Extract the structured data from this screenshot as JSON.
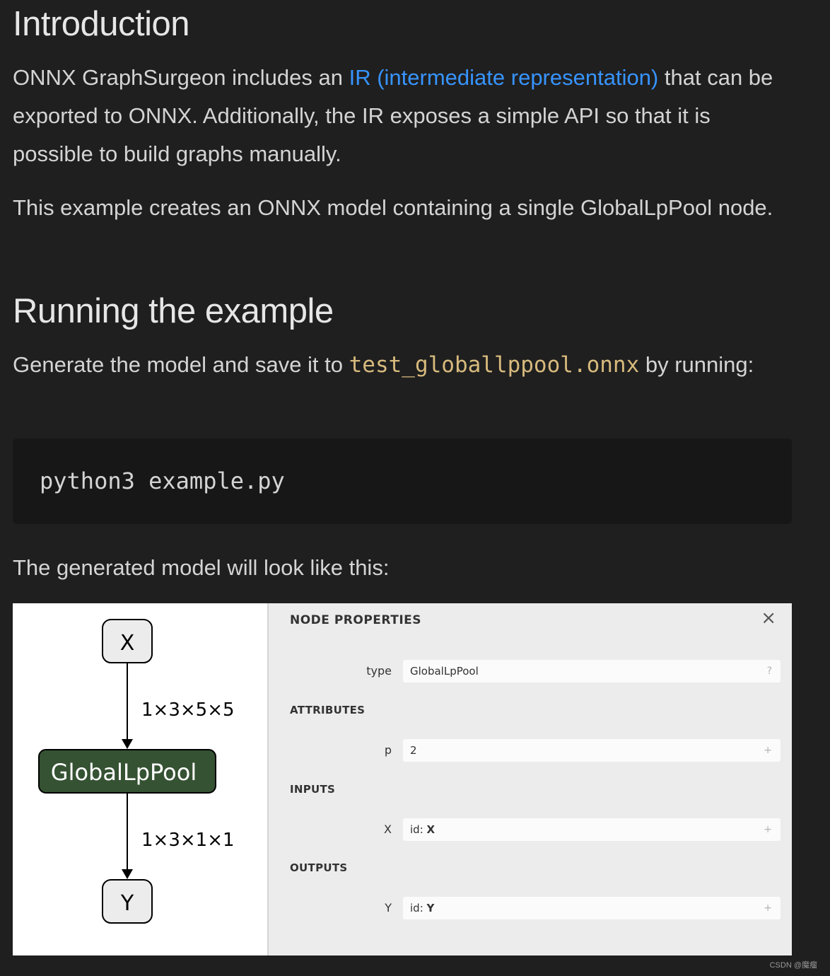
{
  "intro": {
    "heading": "Introduction",
    "p1_before": "ONNX GraphSurgeon includes an ",
    "p1_link": "IR (intermediate representation)",
    "p1_after": " that can be exported to ONNX. Additionally, the IR exposes a simple API so that it is possible to build graphs manually.",
    "p2": "This example creates an ONNX model containing a single GlobalLpPool node."
  },
  "running": {
    "heading": "Running the example",
    "p3_before": "Generate the model and save it to ",
    "p3_code": "test_globallppool.onnx",
    "p3_after": " by running:",
    "code": "python3 example.py",
    "p4": "The generated model will look like this:"
  },
  "graph": {
    "input_node": "X",
    "op_node": "GlobalLpPool",
    "output_node": "Y",
    "edge1_label": "1×3×5×5",
    "edge2_label": "1×3×1×1",
    "op_color": "#355233"
  },
  "panel": {
    "title": "NODE PROPERTIES",
    "close_icon": "×",
    "type_label": "type",
    "type_value": "GlobalLpPool",
    "type_suffix": "?",
    "attributes_heading": "ATTRIBUTES",
    "attr_label": "p",
    "attr_value": "2",
    "attr_suffix": "+",
    "inputs_heading": "INPUTS",
    "input_label": "X",
    "input_prefix": "id: ",
    "input_value": "X",
    "input_suffix": "+",
    "outputs_heading": "OUTPUTS",
    "output_label": "Y",
    "output_prefix": "id: ",
    "output_value": "Y",
    "output_suffix": "+"
  },
  "watermark": "CSDN @魔瘤"
}
